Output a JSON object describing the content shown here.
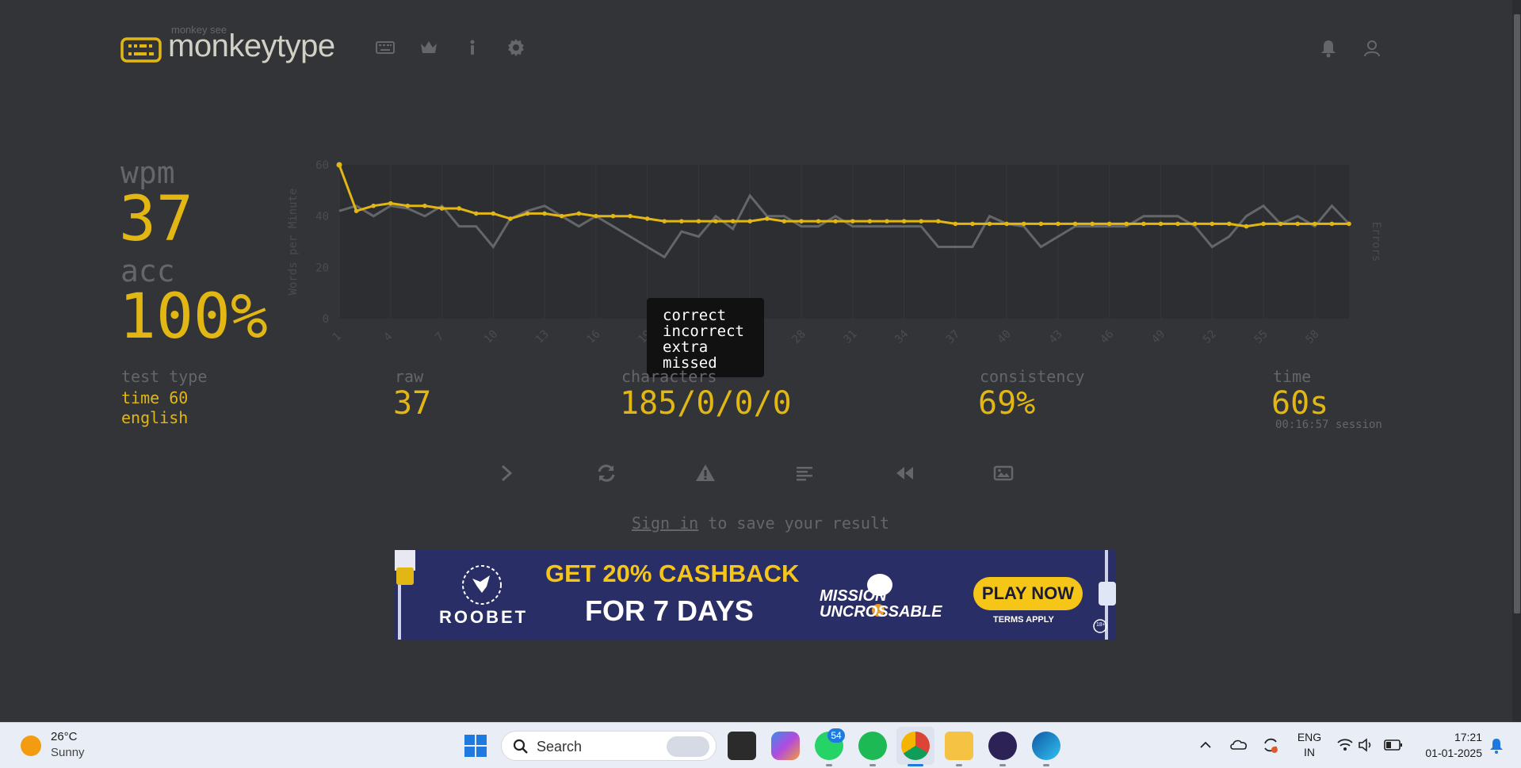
{
  "header": {
    "logo_small": "monkey see",
    "logo_text": "monkeytype",
    "nav_icons": [
      "keyboard-icon",
      "crown-icon",
      "info-icon",
      "gear-icon"
    ],
    "right_icons": [
      "bell-icon",
      "user-icon"
    ]
  },
  "stats": {
    "wpm_label": "wpm",
    "wpm_value": "37",
    "acc_label": "acc",
    "acc_value": "100%",
    "test_type_label": "test type",
    "test_type_line1": "time 60",
    "test_type_line2": "english",
    "raw_label": "raw",
    "raw_value": "37",
    "characters_label": "characters",
    "characters_value": "185/0/0/0",
    "consistency_label": "consistency",
    "consistency_value": "69%",
    "time_label": "time",
    "time_value": "60s",
    "session_text": "00:16:57 session"
  },
  "chart_data": {
    "type": "line",
    "ylabel": "Words per Minute",
    "y2label": "Errors",
    "ylim": [
      0,
      60
    ],
    "yticks": [
      "0",
      "20",
      "40",
      "60"
    ],
    "xtick_labels": [
      "1",
      "4",
      "7",
      "10",
      "13",
      "16",
      "19",
      "22",
      "25",
      "28",
      "31",
      "34",
      "37",
      "40",
      "43",
      "46",
      "49",
      "52",
      "55",
      "58"
    ],
    "x": [
      1,
      2,
      3,
      4,
      5,
      6,
      7,
      8,
      9,
      10,
      11,
      12,
      13,
      14,
      15,
      16,
      17,
      18,
      19,
      20,
      21,
      22,
      23,
      24,
      25,
      26,
      27,
      28,
      29,
      30,
      31,
      32,
      33,
      34,
      35,
      36,
      37,
      38,
      39,
      40,
      41,
      42,
      43,
      44,
      45,
      46,
      47,
      48,
      49,
      50,
      51,
      52,
      53,
      54,
      55,
      56,
      57,
      58,
      59,
      60
    ],
    "series": [
      {
        "values": [
          60,
          42,
          44,
          45,
          44,
          44,
          43,
          43,
          41,
          41,
          39,
          41,
          41,
          40,
          41,
          40,
          40,
          40,
          39,
          38,
          38,
          38,
          38,
          38,
          38,
          39,
          38,
          38,
          38,
          38,
          38,
          38,
          38,
          38,
          38,
          38,
          37,
          37,
          37,
          37,
          37,
          37,
          37,
          37,
          37,
          37,
          37,
          37,
          37,
          37,
          37,
          37,
          37,
          36,
          37,
          37,
          37,
          37,
          37,
          37
        ],
        "color": "#e2b714"
      },
      {
        "values": [
          42,
          44,
          40,
          44,
          43,
          40,
          44,
          36,
          36,
          28,
          39,
          42,
          44,
          40,
          36,
          40,
          36,
          32,
          28,
          24,
          34,
          32,
          40,
          35,
          48,
          40,
          40,
          36,
          36,
          40,
          36,
          36,
          36,
          36,
          36,
          28,
          28,
          28,
          40,
          37,
          36,
          28,
          32,
          36,
          36,
          36,
          36,
          40,
          40,
          40,
          36,
          28,
          32,
          40,
          44,
          37,
          40,
          36,
          44,
          37
        ],
        "color": "#646669"
      }
    ],
    "tooltip": [
      "correct",
      "incorrect",
      "extra",
      "missed"
    ]
  },
  "actions": [
    "next-test-icon",
    "restart-icon",
    "warning-icon",
    "words-history-icon",
    "replay-icon",
    "screenshot-icon"
  ],
  "signin": {
    "link": "Sign in",
    "rest": " to save your result"
  },
  "ad": {
    "brand": "ROOBET",
    "headline1": "GET 20% CASHBACK",
    "headline2": "FOR 7 DAYS",
    "mission_line1": "MISSION",
    "mission_line2": "UNCROSSABLE",
    "cta": "PLAY NOW",
    "terms": "TERMS APPLY",
    "age": "18+"
  },
  "taskbar": {
    "weather_temp": "26°C",
    "weather_cond": "Sunny",
    "search_placeholder": "Search",
    "whatsapp_badge": "54",
    "lang_line1": "ENG",
    "lang_line2": "IN",
    "time": "17:21",
    "date": "01-01-2025"
  }
}
